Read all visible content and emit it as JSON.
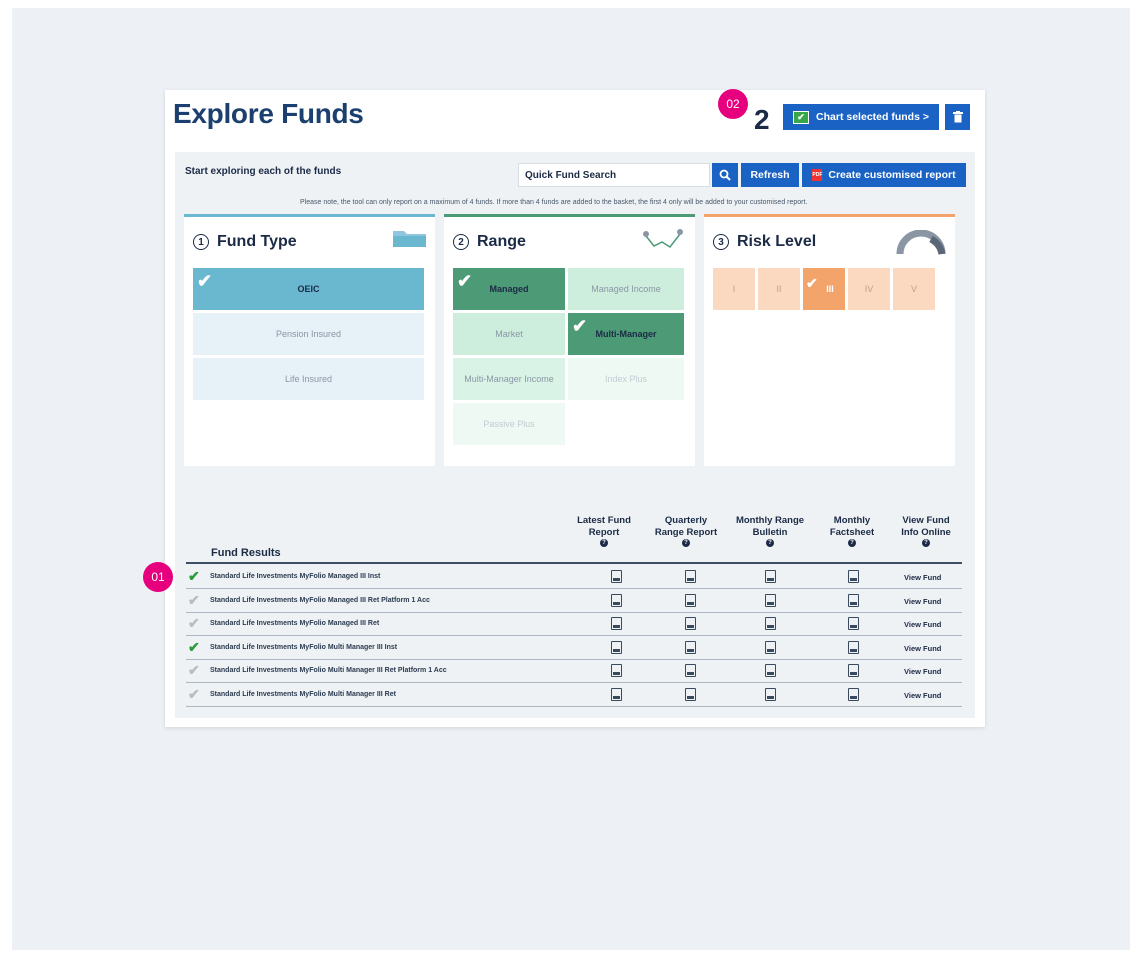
{
  "header": {
    "title": "Explore Funds",
    "selected_count": "2",
    "chart_button_label": "Chart selected funds >"
  },
  "toolbar": {
    "subheading": "Start exploring each of the funds",
    "search_placeholder": "Quick Fund Search",
    "refresh_label": "Refresh",
    "create_report_label": "Create customised report",
    "note": "Please note, the tool can only report on a maximum of 4 funds. If more than 4 funds are added to the basket, the first 4 only will be added to your customised report."
  },
  "fund_type": {
    "number": "1",
    "title": "Fund Type",
    "options": [
      {
        "label": "OEIC",
        "selected": true
      },
      {
        "label": "Pension Insured",
        "selected": false
      },
      {
        "label": "Life Insured",
        "selected": false
      }
    ]
  },
  "range": {
    "number": "2",
    "title": "Range",
    "options": [
      {
        "label": "Managed",
        "selected": true
      },
      {
        "label": "Managed Income",
        "selected": false
      },
      {
        "label": "Market",
        "selected": false
      },
      {
        "label": "Multi-Manager",
        "selected": true
      },
      {
        "label": "Multi-Manager Income",
        "selected": false
      },
      {
        "label": "Index Plus",
        "selected": false
      },
      {
        "label": "Passive Plus",
        "selected": false
      }
    ]
  },
  "risk": {
    "number": "3",
    "title": "Risk Level",
    "options": [
      {
        "label": "I",
        "selected": false
      },
      {
        "label": "II",
        "selected": false
      },
      {
        "label": "III",
        "selected": true
      },
      {
        "label": "IV",
        "selected": false
      },
      {
        "label": "V",
        "selected": false
      }
    ]
  },
  "results": {
    "label": "Fund Results",
    "columns": [
      "Latest Fund Report",
      "Quarterly Range Report",
      "Monthly Range Bulletin",
      "Monthly Factsheet",
      "View Fund Info Online"
    ],
    "view_label": "View Fund",
    "rows": [
      {
        "name": "Standard Life Investments MyFolio Managed III Inst",
        "selected": true
      },
      {
        "name": "Standard Life Investments MyFolio Managed III Ret Platform 1 Acc",
        "selected": false
      },
      {
        "name": "Standard Life Investments MyFolio Managed III Ret",
        "selected": false
      },
      {
        "name": "Standard Life Investments MyFolio Multi Manager III Inst",
        "selected": true
      },
      {
        "name": "Standard Life Investments MyFolio Multi Manager III Ret Platform 1 Acc",
        "selected": false
      },
      {
        "name": "Standard Life Investments MyFolio Multi Manager III Ret",
        "selected": false
      }
    ]
  },
  "annotations": {
    "marker_1": "01",
    "marker_2": "02"
  },
  "colors": {
    "accent_blue": "#1a63c4",
    "fund_type": "#6ab7d0",
    "range": "#4d9a76",
    "risk": "#f2a46b",
    "marker": "#e6007e",
    "check_selected": "#2a9a3a",
    "check_unselected": "#b5bcc4"
  }
}
